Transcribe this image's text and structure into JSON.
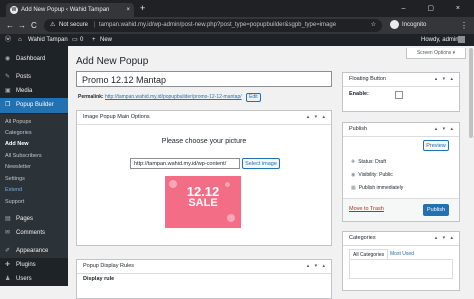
{
  "browser": {
    "tab_title": "Add New Popup ‹ Wahid Tampan",
    "tab_close": "×",
    "new_tab": "+",
    "window_controls": "– ▢ ×",
    "nav_back": "←",
    "nav_forward": "→",
    "nav_reload": "C",
    "security_warning": "Not secure",
    "url_separator": "|",
    "url": "tampan.wahid.my.id/wp-admin/post-new.php?post_type=popupbuilder&sgpb_type=image",
    "incognito_label": "Incognito",
    "menu_dots": "⋮"
  },
  "admin_bar": {
    "site_name": "Wahid Tampan",
    "comments_count": "0",
    "new_label": "New",
    "howdy": "Howdy, admin"
  },
  "sidebar": {
    "items": [
      {
        "icon": "dashboard-icon",
        "glyph": "◉",
        "label": "Dashboard"
      },
      {
        "icon": "pin-icon",
        "glyph": "✎",
        "label": "Posts"
      },
      {
        "icon": "media-icon",
        "glyph": "▣",
        "label": "Media"
      },
      {
        "icon": "popup-icon",
        "glyph": "❒",
        "label": "Popup Builder"
      },
      {
        "icon": "pages-icon",
        "glyph": "▤",
        "label": "Pages"
      },
      {
        "icon": "comments-icon",
        "glyph": "✉",
        "label": "Comments"
      },
      {
        "icon": "appearance-icon",
        "glyph": "✐",
        "label": "Appearance"
      },
      {
        "icon": "plugins-icon",
        "glyph": "✚",
        "label": "Plugins"
      },
      {
        "icon": "users-icon",
        "glyph": "♟",
        "label": "Users"
      }
    ],
    "submenu": [
      "All Popups",
      "Categories",
      "Add New",
      "All Subscribers",
      "Newsletter",
      "Settings",
      "Extend",
      "Support"
    ],
    "current_submenu_index": 2
  },
  "screen_options": "Screen Options ▾",
  "page_title": "Add New Popup",
  "post_title": "Promo 12.12 Mantap",
  "permalink": {
    "label": "Permalink:",
    "url": "http://tampan.wahid.my.id/popupbuilder/promo-12-12-mantap/",
    "edit": "Edit"
  },
  "image_box": {
    "title": "Image Popup Main Options",
    "controls": "▴ ▾ ▴",
    "prompt": "Please choose your picture",
    "url_value": "http://tampan.wahid.my.id/wp-content/",
    "select_button": "Select image",
    "image_text": {
      "line1": "12.12",
      "line2": "SALE"
    }
  },
  "display_box": {
    "title": "Popup Display Rules",
    "controls": "▴ ▾ ▴",
    "rule_label": "Display rule"
  },
  "floating_box": {
    "title": "Floating Button",
    "controls": "▴ ▾ ▴",
    "enable_label": "Enable:",
    "checked": false
  },
  "publish_box": {
    "title": "Publish",
    "controls": "▴ ▾ ▴",
    "preview": "Preview",
    "status": "Status: Draft",
    "visibility": "Visibility: Public",
    "publish_time": "Publish immediately",
    "trash": "Move to Trash",
    "publish_button": "Publish"
  },
  "categories_box": {
    "title": "Categories",
    "controls": "▴ ▾ ▴",
    "tab_all": "All Categories",
    "tab_most": "Most Used"
  },
  "colors": {
    "accent": "#2271b1",
    "admin_dark": "#1d2327",
    "sale_pink": "#f26d85"
  }
}
